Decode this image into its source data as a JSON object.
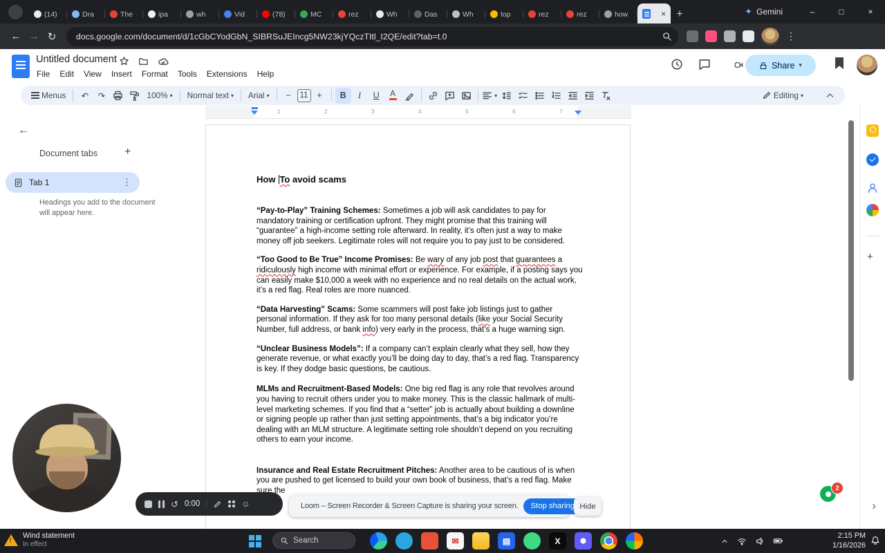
{
  "colors": {
    "accent_blue": "#1a73e8",
    "share_bg": "#c2e7ff",
    "selected_tab_bg": "#d3e3fd",
    "squiggle_red": "#d93025",
    "toolbar_bg": "#edf2fa"
  },
  "browser": {
    "gemini_label": "Gemini",
    "url": "docs.google.com/document/d/1cGbCYodGbN_SIBRSuJEIncg5NW23kjYQczTItl_I2QE/edit?tab=t.0",
    "tabs": [
      {
        "label": "(14)",
        "color": "#e8eaed"
      },
      {
        "label": "Dra",
        "color": "#8ab4f8"
      },
      {
        "label": "The",
        "color": "#ea4335"
      },
      {
        "label": "ipa",
        "color": "#f1f3f4"
      },
      {
        "label": "wh",
        "color": "#9aa0a6"
      },
      {
        "label": "Vid",
        "color": "#4285f4"
      },
      {
        "label": "(78)",
        "color": "#ff0000"
      },
      {
        "label": "MC",
        "color": "#34a853"
      },
      {
        "label": "rez",
        "color": "#ea4335"
      },
      {
        "label": "Wh",
        "color": "#e8eaed"
      },
      {
        "label": "Das",
        "color": "#5f6368"
      },
      {
        "label": "Wh",
        "color": "#bdc1c6"
      },
      {
        "label": "top",
        "color": "#fbbc04"
      },
      {
        "label": "rez",
        "color": "#ea4335"
      },
      {
        "label": "rez",
        "color": "#ea4335"
      },
      {
        "label": "how",
        "color": "#9aa0a6"
      }
    ]
  },
  "docs": {
    "doc_title": "Untitled document",
    "menus": [
      "File",
      "Edit",
      "View",
      "Insert",
      "Format",
      "Tools",
      "Extensions",
      "Help"
    ],
    "share_label": "Share",
    "toolbar": {
      "menus_label": "Menus",
      "zoom": "100%",
      "styles": "Normal text",
      "font": "Arial",
      "font_size": "11",
      "bold": "B",
      "italic": "I",
      "underline": "U",
      "editing_label": "Editing"
    },
    "ruler_numbers": [
      "1",
      "2",
      "3",
      "4",
      "5",
      "6",
      "7"
    ],
    "panel": {
      "header": "Document tabs",
      "tab_label": "Tab 1",
      "hint": "Headings you add to the document will appear here."
    }
  },
  "document": {
    "title_segments": [
      {
        "t": "How "
      },
      {
        "caret": true
      },
      {
        "t": "To",
        "sq": true
      },
      {
        "t": " avoid scams"
      }
    ],
    "paragraphs": [
      {
        "lead": "“Pay-to-Play” Training Schemes:",
        "segments": [
          {
            "t": " Sometimes a job will ask candidates to pay for mandatory training or certification upfront. They might promise that this training will “guarantee” a high-income setting role afterward. In reality, it’s often just a way to make money off job seekers. Legitimate roles will not require you to pay just to be considered."
          }
        ]
      },
      {
        "lead": "“Too Good to Be True” Income Promises:",
        "segments": [
          {
            "t": " Be "
          },
          {
            "t": "wary",
            "sq": true
          },
          {
            "t": " of any job "
          },
          {
            "t": "post",
            "sq": true
          },
          {
            "t": " that "
          },
          {
            "t": "guarantees",
            "sq": true
          },
          {
            "t": " a "
          },
          {
            "t": "ridiculously",
            "sq": true
          },
          {
            "t": " high income with minimal effort or experience. For example, if a posting says you can easily make $10,000 a week with no experience and no real details on the actual work, it’s a red flag. Real roles are more nuanced."
          }
        ]
      },
      {
        "lead": "“Data Harvesting” Scams:",
        "segments": [
          {
            "t": " Some scammers will post fake job listings just to gather personal information. If they ask for too many personal details ("
          },
          {
            "t": "like",
            "sq": true
          },
          {
            "t": " your Social Security Number, full address, or bank "
          },
          {
            "t": "info",
            "sq": true
          },
          {
            "t": ") very early in the process, that’s a huge warning sign."
          }
        ]
      },
      {
        "lead": "“Unclear Business Models”:",
        "segments": [
          {
            "t": " If a company can’t explain clearly what they sell, how they generate revenue, or what exactly you’ll be doing day to day, that’s a red flag. Transparency is key. If they dodge basic questions, be cautious."
          }
        ]
      },
      {
        "lead": "MLMs and Recruitment-Based Models:",
        "gap": "lg",
        "segments": [
          {
            "t": " One big red flag is any role that revolves around you having to recruit others under you to make money. This is the classic hallmark of multi-level marketing schemes. If you find that a “setter” job is actually about building a downline or signing people up rather than just setting appointments, that’s a big indicator you’re dealing with an MLM structure. A legitimate setting role shouldn’t depend on you recruiting others to earn your income."
          }
        ]
      },
      {
        "lead": "Insurance and Real Estate Recruitment Pitches:",
        "gap": "xl",
        "segments": [
          {
            "t": " Another area to be cautious of is when you are pushed to get licensed to build your own book of business, that’s a red flag. Make sure the"
          }
        ]
      }
    ]
  },
  "loom": {
    "time": "0:00",
    "notice": "Loom – Screen Recorder & Screen Capture is sharing your screen.",
    "stop_sharing": "Stop sharing",
    "hide": "Hide"
  },
  "overlay": {
    "badge_count": "2"
  },
  "taskbar": {
    "weather_title": "Wind statement",
    "weather_sub": "In effect",
    "search_placeholder": "Search",
    "time": "2:15 PM",
    "date": "1/16/2026",
    "apps": [
      {
        "name": "edge-browser",
        "shape": "circle",
        "bg": "conic-gradient(from 220deg,#0c59f2 0 120deg,#2ba3ec 120deg 230deg,#35d48a 230deg 360deg)"
      },
      {
        "name": "messaging-app",
        "shape": "circle",
        "bg": "#2aa5e0"
      },
      {
        "name": "orange-app",
        "shape": "square",
        "bg": "#e8513a"
      },
      {
        "name": "mail-app",
        "shape": "square",
        "bg": "#f4f6f8",
        "glyph": "✉",
        "glyph_color": "#d93025"
      },
      {
        "name": "file-explorer",
        "shape": "square",
        "bg": "linear-gradient(180deg,#ffd45e 0%,#f5b91e 100%)"
      },
      {
        "name": "store-app",
        "shape": "square",
        "bg": "#2563eb",
        "glyph": "▤",
        "glyph_color": "#ffffff"
      },
      {
        "name": "green-app",
        "shape": "circle",
        "bg": "#3ddc84"
      },
      {
        "name": "x-app",
        "shape": "square",
        "bg": "#0a0a0a",
        "glyph": "X",
        "glyph_color": "#ffffff"
      },
      {
        "name": "loom-app",
        "shape": "square",
        "bg": "radial-gradient(circle at 50% 50%, #ffffff 0 4px, #615cf5 4px)"
      },
      {
        "name": "chrome-browser",
        "shape": "circle",
        "bg": "radial-gradient(circle at 50% 50%, #4285f4 0 5px, #ffffff 5px 6.5px, rgba(0,0,0,0) 6.5px), conic-gradient(#ea4335 0 120deg, #fbbc04 120deg 240deg, #34a853 240deg 360deg)"
      },
      {
        "name": "photos-app",
        "shape": "circle",
        "bg": "conic-gradient(#ff6d00 0 90deg, #ffab00 90deg 180deg, #00c853 180deg 270deg, #2962ff 270deg 360deg)"
      }
    ]
  }
}
